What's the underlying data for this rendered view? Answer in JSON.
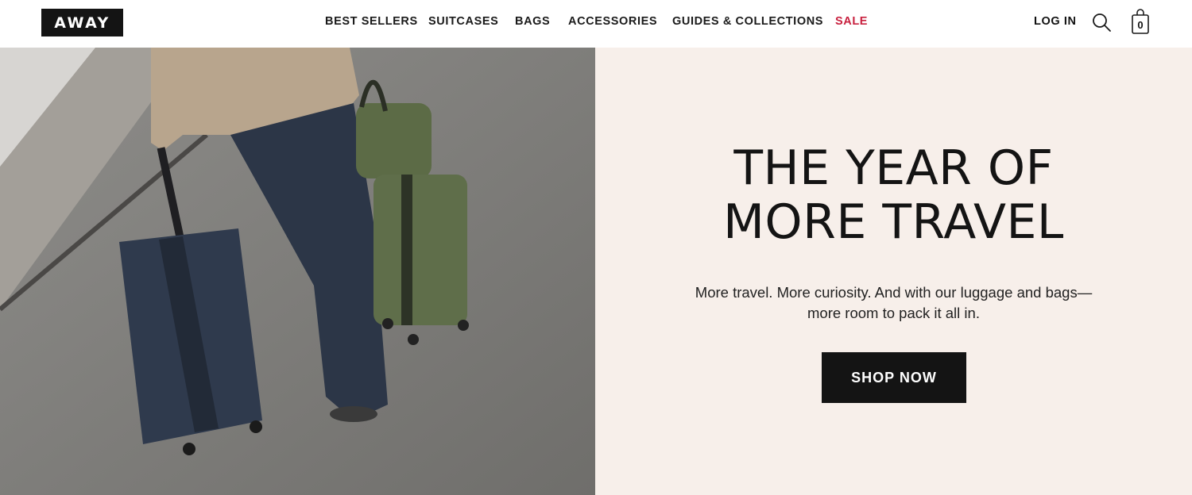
{
  "header": {
    "logo": "AWAY",
    "nav": [
      {
        "label": "BEST SELLERS"
      },
      {
        "label": "SUITCASES"
      },
      {
        "label": "BAGS"
      },
      {
        "label": "ACCESSORIES"
      },
      {
        "label": "GUIDES & COLLECTIONS"
      },
      {
        "label": "SALE"
      }
    ],
    "login_label": "LOG IN",
    "search_icon": "search-icon",
    "cart_icon": "shopping-bag-icon",
    "cart_count": "0"
  },
  "hero": {
    "image_description_icon": "photo",
    "headline_line1": "THE YEAR OF",
    "headline_line2": "MORE TRAVEL",
    "subtext_line1": "More travel. More curiosity. And with our luggage and bags—",
    "subtext_line2": "more room to pack it all in.",
    "cta_label": "SHOP NOW"
  },
  "colors": {
    "accent_sale": "#c8203e",
    "panel_bg": "#f7efea",
    "button_bg": "#141414"
  }
}
